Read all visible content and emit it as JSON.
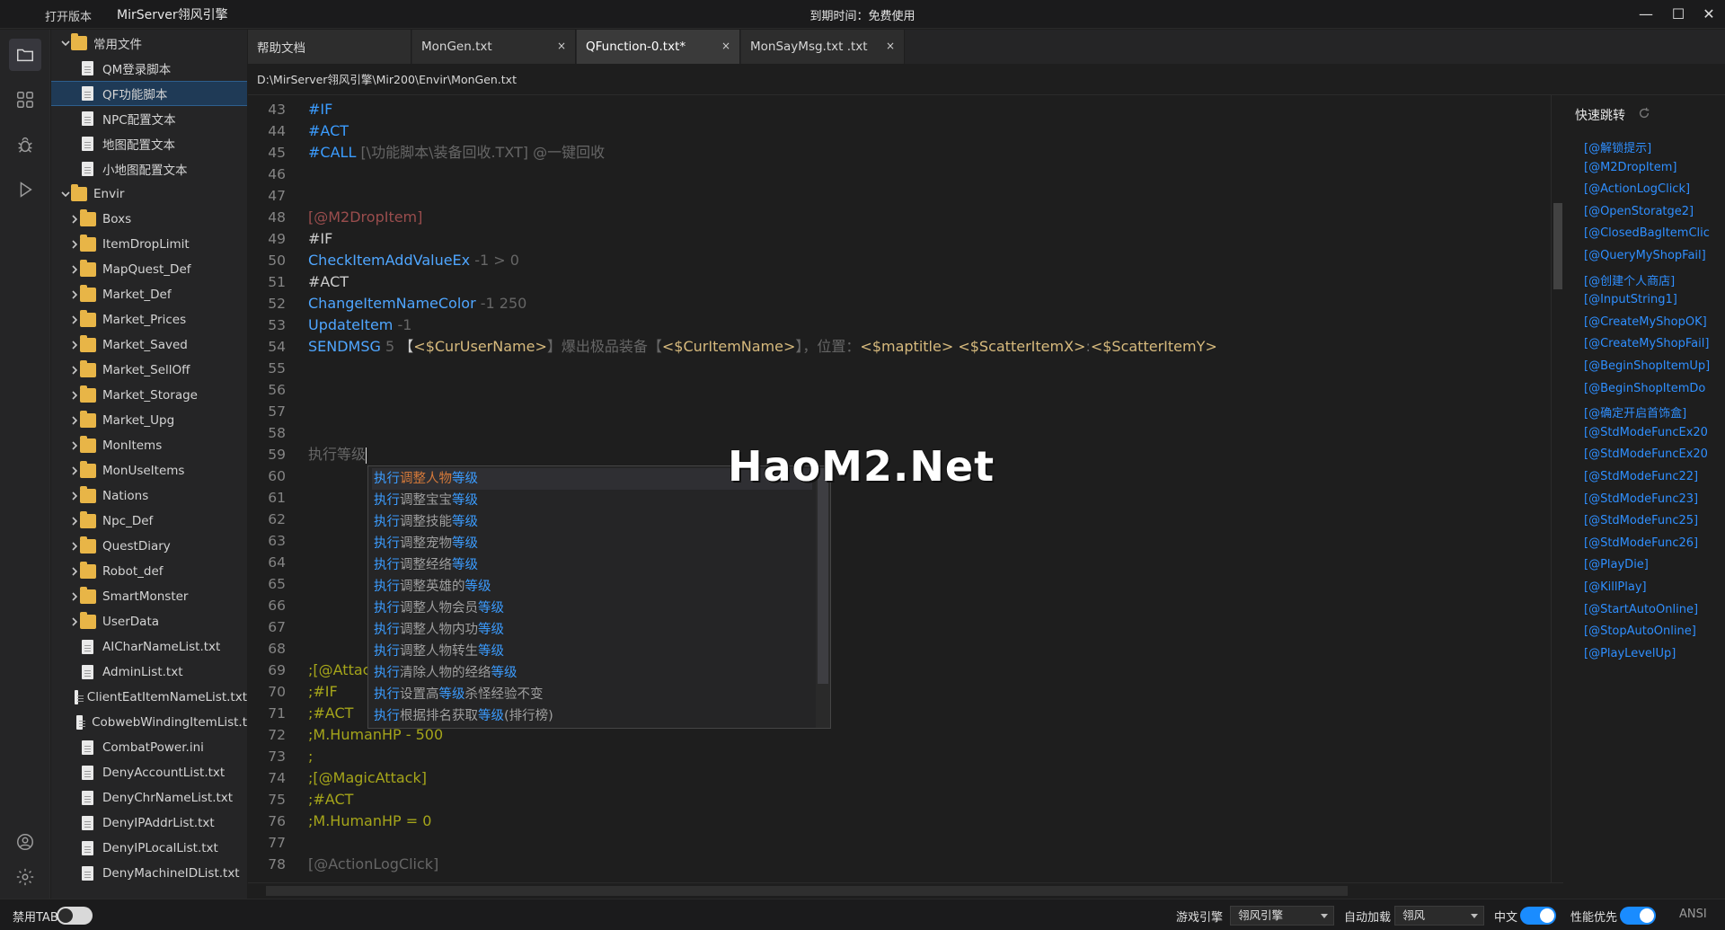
{
  "titlebar": {
    "open_version": "打开版本",
    "app_title": "MirServer翎风引擎",
    "expire": "到期时间：免费使用",
    "minimize": "—",
    "maximize": "☐",
    "close": "✕"
  },
  "activity_icons": [
    "folder-icon",
    "extensions-icon",
    "bug-icon",
    "run-icon",
    "account-icon",
    "settings-icon"
  ],
  "sidebar": {
    "items": [
      {
        "label": "常用文件",
        "type": "folder",
        "expanded": true,
        "indent": 0
      },
      {
        "label": "QM登录脚本",
        "type": "file",
        "indent": 1
      },
      {
        "label": "QF功能脚本",
        "type": "file",
        "indent": 1,
        "selected": true
      },
      {
        "label": "NPC配置文本",
        "type": "file",
        "indent": 1
      },
      {
        "label": "地图配置文本",
        "type": "file",
        "indent": 1
      },
      {
        "label": "小地图配置文本",
        "type": "file",
        "indent": 1
      },
      {
        "label": "Envir",
        "type": "folder",
        "expanded": true,
        "indent": 0
      },
      {
        "label": "Boxs",
        "type": "folder",
        "indent": 1
      },
      {
        "label": "ItemDropLimit",
        "type": "folder",
        "indent": 1
      },
      {
        "label": "MapQuest_Def",
        "type": "folder",
        "indent": 1
      },
      {
        "label": "Market_Def",
        "type": "folder",
        "indent": 1
      },
      {
        "label": "Market_Prices",
        "type": "folder",
        "indent": 1
      },
      {
        "label": "Market_Saved",
        "type": "folder",
        "indent": 1
      },
      {
        "label": "Market_SellOff",
        "type": "folder",
        "indent": 1
      },
      {
        "label": "Market_Storage",
        "type": "folder",
        "indent": 1
      },
      {
        "label": "Market_Upg",
        "type": "folder",
        "indent": 1
      },
      {
        "label": "MonItems",
        "type": "folder",
        "indent": 1
      },
      {
        "label": "MonUseItems",
        "type": "folder",
        "indent": 1
      },
      {
        "label": "Nations",
        "type": "folder",
        "indent": 1
      },
      {
        "label": "Npc_Def",
        "type": "folder",
        "indent": 1
      },
      {
        "label": "QuestDiary",
        "type": "folder",
        "indent": 1
      },
      {
        "label": "Robot_def",
        "type": "folder",
        "indent": 1
      },
      {
        "label": "SmartMonster",
        "type": "folder",
        "indent": 1
      },
      {
        "label": "UserData",
        "type": "folder",
        "indent": 1
      },
      {
        "label": "AICharNameList.txt",
        "type": "file",
        "indent": 1
      },
      {
        "label": "AdminList.txt",
        "type": "file",
        "indent": 1
      },
      {
        "label": "ClientEatItemNameList.txt",
        "type": "file",
        "indent": 1
      },
      {
        "label": "CobwebWindingItemList.t",
        "type": "file",
        "indent": 1
      },
      {
        "label": "CombatPower.ini",
        "type": "file",
        "indent": 1
      },
      {
        "label": "DenyAccountList.txt",
        "type": "file",
        "indent": 1
      },
      {
        "label": "DenyChrNameList.txt",
        "type": "file",
        "indent": 1
      },
      {
        "label": "DenyIPAddrList.txt",
        "type": "file",
        "indent": 1
      },
      {
        "label": "DenyIPLocalList.txt",
        "type": "file",
        "indent": 1
      },
      {
        "label": "DenyMachineIDList.txt",
        "type": "file",
        "indent": 1
      }
    ]
  },
  "tabs": [
    {
      "label": "帮助文档",
      "closable": false,
      "active": false
    },
    {
      "label": "MonGen.txt",
      "closable": true,
      "active": false
    },
    {
      "label": "QFunction-0.txt*",
      "closable": true,
      "active": true
    },
    {
      "label": "MonSayMsg.txt .txt",
      "closable": true,
      "active": false
    }
  ],
  "tab_close_glyph": "×",
  "breadcrumb": "D:\\MirServer翎风引擎\\Mir200\\Envir\\MonGen.txt",
  "editor": {
    "lines": [
      {
        "n": "43",
        "tokens": [
          [
            "#IF",
            "kw-blue"
          ]
        ]
      },
      {
        "n": "44",
        "tokens": [
          [
            "#ACT",
            "kw-blue"
          ]
        ]
      },
      {
        "n": "45",
        "tokens": [
          [
            "#CALL ",
            "kw-blue"
          ],
          [
            "[\\功能脚本\\装备回收.TXT] @一键回收",
            "kw-gray"
          ]
        ]
      },
      {
        "n": "46",
        "tokens": []
      },
      {
        "n": "47",
        "tokens": []
      },
      {
        "n": "48",
        "tokens": [
          [
            "[@M2DropItem]",
            "kw-label"
          ]
        ]
      },
      {
        "n": "49",
        "tokens": [
          [
            "#IF",
            "kw-white"
          ]
        ]
      },
      {
        "n": "50",
        "tokens": [
          [
            "CheckItemAddValueEx",
            "kw-fn"
          ],
          [
            " -1 > 0",
            "kw-gray"
          ]
        ]
      },
      {
        "n": "51",
        "tokens": [
          [
            "#ACT",
            "kw-white"
          ]
        ]
      },
      {
        "n": "52",
        "tokens": [
          [
            "ChangeItemNameColor",
            "kw-fn"
          ],
          [
            " -1 250",
            "kw-gray"
          ]
        ]
      },
      {
        "n": "53",
        "tokens": [
          [
            "UpdateItem",
            "kw-fn"
          ],
          [
            " -1",
            "kw-gray"
          ]
        ]
      },
      {
        "n": "54",
        "tokens": [
          [
            "SENDMSG",
            "kw-fn"
          ],
          [
            " 5 ",
            "kw-gray"
          ],
          [
            "【",
            "kw-white"
          ],
          [
            "<$CurUserName>",
            "kw-var"
          ],
          [
            "】爆出极品装备【",
            "kw-gray"
          ],
          [
            "<$CurItemName>",
            "kw-var"
          ],
          [
            "】，位置：",
            "kw-gray"
          ],
          [
            "<$maptitle>",
            "kw-var"
          ],
          [
            " ",
            "kw-gray"
          ],
          [
            "<$ScatterItemX>",
            "kw-var"
          ],
          [
            ":",
            "kw-gray"
          ],
          [
            "<$ScatterItemY>",
            "kw-var"
          ]
        ]
      },
      {
        "n": "55",
        "tokens": []
      },
      {
        "n": "56",
        "tokens": []
      },
      {
        "n": "57",
        "tokens": []
      },
      {
        "n": "58",
        "tokens": []
      },
      {
        "n": "59",
        "tokens": [
          [
            "执行等级",
            "kw-gray"
          ]
        ],
        "caret": true
      },
      {
        "n": "60",
        "tokens": []
      },
      {
        "n": "61",
        "tokens": []
      },
      {
        "n": "62",
        "tokens": []
      },
      {
        "n": "63",
        "tokens": []
      },
      {
        "n": "64",
        "tokens": []
      },
      {
        "n": "65",
        "tokens": []
      },
      {
        "n": "66",
        "tokens": []
      },
      {
        "n": "67",
        "tokens": []
      },
      {
        "n": "68",
        "tokens": []
      },
      {
        "n": "69",
        "tokens": [
          [
            ";[@Attac",
            "kw-olive"
          ]
        ]
      },
      {
        "n": "70",
        "tokens": [
          [
            ";#IF",
            "kw-olive"
          ]
        ]
      },
      {
        "n": "71",
        "tokens": [
          [
            ";#ACT",
            "kw-olive"
          ]
        ]
      },
      {
        "n": "72",
        "tokens": [
          [
            ";M.HumanHP - 500",
            "kw-olive"
          ]
        ]
      },
      {
        "n": "73",
        "tokens": [
          [
            ";",
            "kw-olive"
          ]
        ]
      },
      {
        "n": "74",
        "tokens": [
          [
            ";[@MagicAttack]",
            "kw-olive"
          ]
        ]
      },
      {
        "n": "75",
        "tokens": [
          [
            ";#ACT",
            "kw-olive"
          ]
        ]
      },
      {
        "n": "76",
        "tokens": [
          [
            ";M.HumanHP = 0",
            "kw-olive"
          ]
        ]
      },
      {
        "n": "77",
        "tokens": []
      },
      {
        "n": "78",
        "tokens": [
          [
            "[@ActionLogClick]",
            "kw-gray"
          ]
        ]
      }
    ]
  },
  "autocomplete": {
    "items": [
      {
        "parts": [
          [
            "执行",
            "kw"
          ],
          [
            "调整人物",
            "rest"
          ],
          [
            "等级",
            "kw"
          ]
        ],
        "selected": true
      },
      {
        "parts": [
          [
            "执行",
            "kw"
          ],
          [
            "调整宝宝",
            "rest"
          ],
          [
            "等级",
            "kw"
          ]
        ]
      },
      {
        "parts": [
          [
            "执行",
            "kw"
          ],
          [
            "调整技能",
            "rest"
          ],
          [
            "等级",
            "kw"
          ]
        ]
      },
      {
        "parts": [
          [
            "执行",
            "kw"
          ],
          [
            "调整宠物",
            "rest"
          ],
          [
            "等级",
            "kw"
          ]
        ]
      },
      {
        "parts": [
          [
            "执行",
            "kw"
          ],
          [
            "调整经络",
            "rest"
          ],
          [
            "等级",
            "kw"
          ]
        ]
      },
      {
        "parts": [
          [
            "执行",
            "kw"
          ],
          [
            "调整英雄的",
            "rest"
          ],
          [
            "等级",
            "kw"
          ]
        ]
      },
      {
        "parts": [
          [
            "执行",
            "kw"
          ],
          [
            "调整人物会员",
            "rest"
          ],
          [
            "等级",
            "kw"
          ]
        ]
      },
      {
        "parts": [
          [
            "执行",
            "kw"
          ],
          [
            "调整人物内功",
            "rest"
          ],
          [
            "等级",
            "kw"
          ]
        ]
      },
      {
        "parts": [
          [
            "执行",
            "kw"
          ],
          [
            "调整人物转生",
            "rest"
          ],
          [
            "等级",
            "kw"
          ]
        ]
      },
      {
        "parts": [
          [
            "执行",
            "kw"
          ],
          [
            "清除人物的经络",
            "rest"
          ],
          [
            "等级",
            "kw"
          ]
        ]
      },
      {
        "parts": [
          [
            "执行",
            "kw"
          ],
          [
            "设置高",
            "rest"
          ],
          [
            "等级",
            "kw"
          ],
          [
            "杀怪经验不变",
            "rest"
          ]
        ]
      },
      {
        "parts": [
          [
            "执行",
            "kw"
          ],
          [
            "根据排名获取",
            "rest"
          ],
          [
            "等级",
            "kw"
          ],
          [
            "(排行榜)",
            "rest"
          ]
        ]
      }
    ]
  },
  "watermark": "HaoM2.Net",
  "quickjump": {
    "title": "快速跳转",
    "items": [
      "[@解锁提示]",
      "[@M2DropItem]",
      "[@ActionLogClick]",
      "[@OpenStoratge2]",
      "[@ClosedBagItemClic",
      "[@QueryMyShopFail]",
      "[@创建个人商店]",
      "[@InputString1]",
      "[@CreateMyShopOK]",
      "[@CreateMyShopFail]",
      "[@BeginShopItemUp]",
      "[@BeginShopItemDo",
      "[@确定开启首饰盒]",
      "[@StdModeFuncEx20",
      "[@StdModeFuncEx20",
      "[@StdModeFunc22]",
      "[@StdModeFunc23]",
      "[@StdModeFunc25]",
      "[@StdModeFunc26]",
      "[@PlayDie]",
      "[@KillPlay]",
      "[@StartAutoOnline]",
      "[@StopAutoOnline]",
      "[@PlayLevelUp]"
    ]
  },
  "statusbar": {
    "disable_tab": "禁用TAB",
    "disable_tab_on": false,
    "game_engine_label": "游戏引擎",
    "game_engine_value": "翎风引擎",
    "auto_load_label": "自动加载",
    "auto_load_value": "翎风",
    "chinese_label": "中文",
    "chinese_on": true,
    "perf_label": "性能优先",
    "perf_on": true,
    "encoding": "ANSI"
  },
  "colors": {
    "accent": "#1a8cff",
    "keyword": "#3b9cff",
    "label": "#9a4d4d",
    "variable": "#d7ba7d",
    "comment": "#a5a51a",
    "folder": "#e8b547"
  }
}
